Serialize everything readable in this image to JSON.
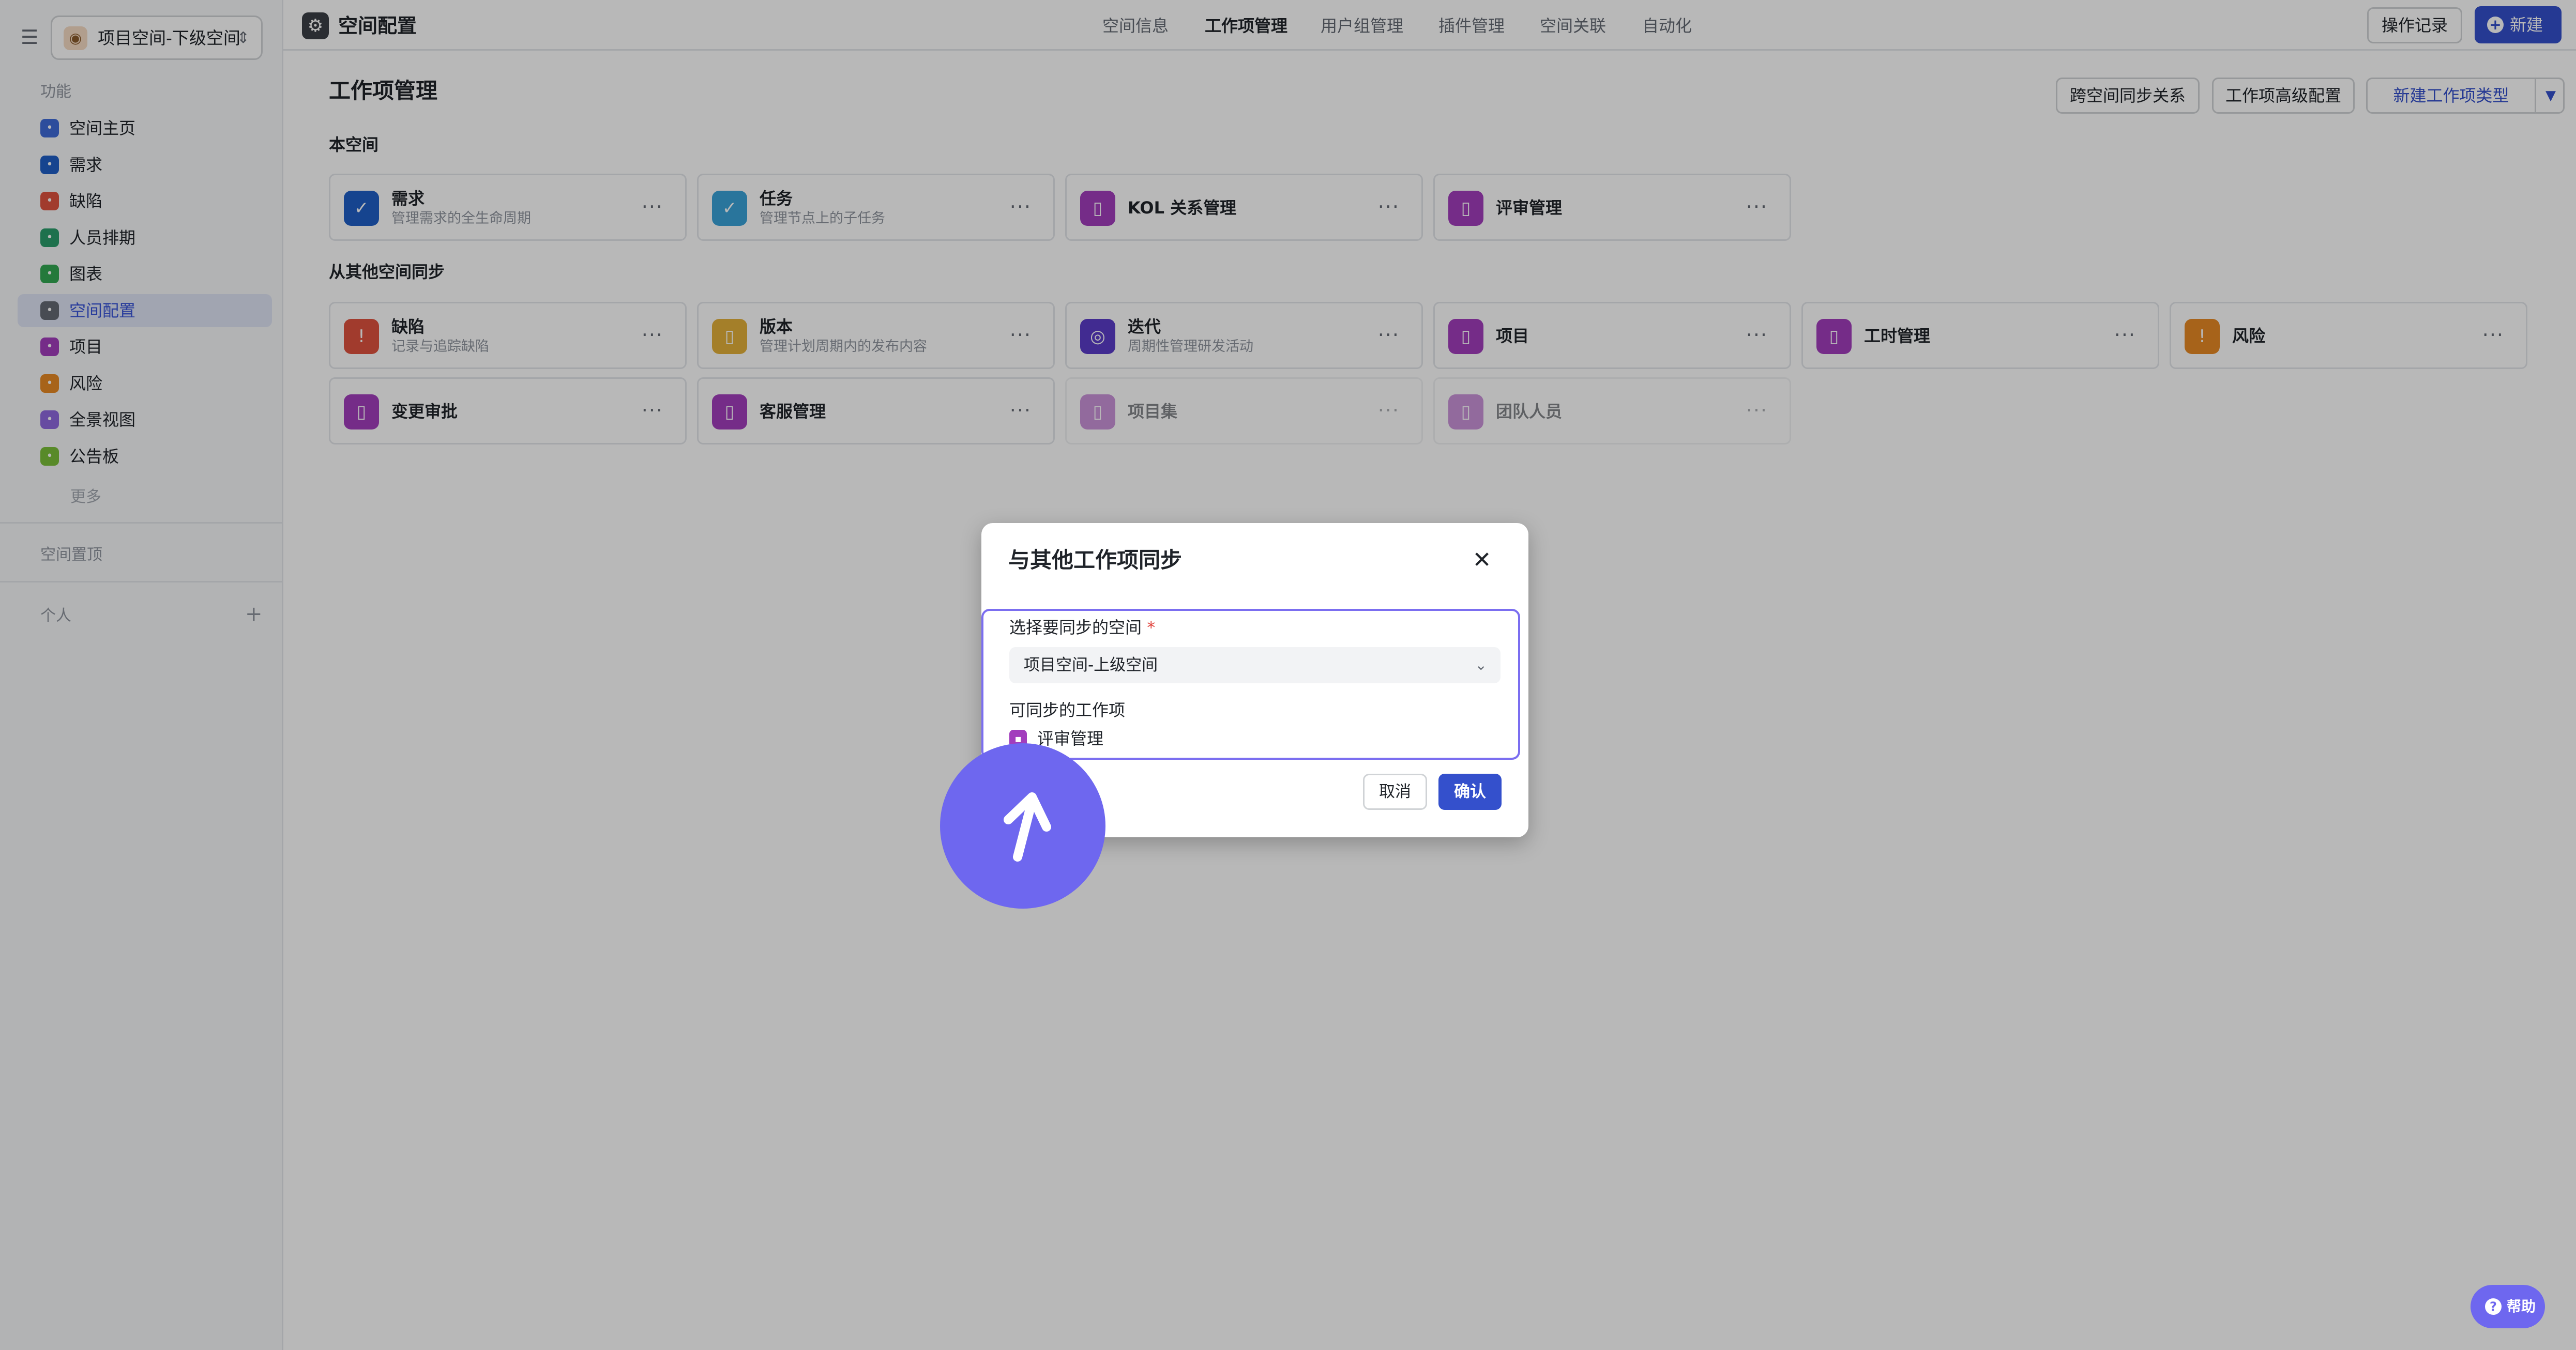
{
  "sidebar": {
    "space_name": "项目空间-下级空间",
    "section_features": "功能",
    "items": [
      {
        "label": "空间主页",
        "icon": "home-icon",
        "color": "#3f6bd8"
      },
      {
        "label": "需求",
        "icon": "requirement-icon",
        "color": "#1f5fc7"
      },
      {
        "label": "缺陷",
        "icon": "bug-icon",
        "color": "#e0523f"
      },
      {
        "label": "人员排期",
        "icon": "schedule-icon",
        "color": "#2a9d6b"
      },
      {
        "label": "图表",
        "icon": "chart-icon",
        "color": "#33a852"
      },
      {
        "label": "空间配置",
        "icon": "gear-icon",
        "color": "#646a73"
      },
      {
        "label": "项目",
        "icon": "project-icon",
        "color": "#a23dbd"
      },
      {
        "label": "风险",
        "icon": "risk-icon",
        "color": "#e88a25"
      },
      {
        "label": "全景视图",
        "icon": "panorama-icon",
        "color": "#8f68e0"
      },
      {
        "label": "公告板",
        "icon": "board-icon",
        "color": "#7bbf3a"
      }
    ],
    "more": "更多",
    "section_pinned": "空间置顶",
    "section_personal": "个人"
  },
  "header": {
    "title": "空间配置",
    "tabs": [
      "空间信息",
      "工作项管理",
      "用户组管理",
      "插件管理",
      "空间关联",
      "自动化"
    ],
    "active_tab": "工作项管理",
    "history_button": "操作记录",
    "new_button": "新建"
  },
  "main": {
    "title": "工作项管理",
    "cross_space_button": "跨空间同步关系",
    "advanced_button": "工作项高级配置",
    "new_type_button": "新建工作项类型",
    "local_group": "本空间",
    "synced_group": "从其他空间同步",
    "local_cards": [
      {
        "name": "需求",
        "desc": "管理需求的全生命周期",
        "icon": "check-circle-icon",
        "color": "#1f5fc7"
      },
      {
        "name": "任务",
        "desc": "管理节点上的子任务",
        "icon": "check-circle-icon",
        "color": "#3aa3d9"
      },
      {
        "name": "KOL 关系管理",
        "desc": "",
        "icon": "bookmark-icon",
        "color": "#a23dbd"
      },
      {
        "name": "评审管理",
        "desc": "",
        "icon": "bookmark-icon",
        "color": "#a23dbd"
      }
    ],
    "synced_cards": [
      {
        "name": "缺陷",
        "desc": "记录与追踪缺陷",
        "icon": "alert-icon",
        "color": "#e0523f"
      },
      {
        "name": "版本",
        "desc": "管理计划周期内的发布内容",
        "icon": "bookmark-icon",
        "color": "#e3b03a"
      },
      {
        "name": "迭代",
        "desc": "周期性管理研发活动",
        "icon": "cycle-icon",
        "color": "#5a3cc9"
      },
      {
        "name": "项目",
        "desc": "",
        "icon": "bookmark-icon",
        "color": "#a23dbd"
      },
      {
        "name": "工时管理",
        "desc": "",
        "icon": "bookmark-icon",
        "color": "#a23dbd"
      },
      {
        "name": "风险",
        "desc": "",
        "icon": "alert-icon",
        "color": "#e88a25"
      },
      {
        "name": "变更审批",
        "desc": "",
        "icon": "bookmark-icon",
        "color": "#a23dbd"
      },
      {
        "name": "客服管理",
        "desc": "",
        "icon": "bookmark-icon",
        "color": "#a23dbd"
      },
      {
        "name": "项目集",
        "desc": "",
        "icon": "bookmark-icon",
        "color": "#a23dbd",
        "dim": true
      },
      {
        "name": "团队人员",
        "desc": "",
        "icon": "bookmark-icon",
        "color": "#a23dbd",
        "dim": true
      }
    ]
  },
  "modal": {
    "title": "与其他工作项同步",
    "space_label": "选择要同步的空间",
    "required_mark": "*",
    "space_value": "项目空间-上级空间",
    "items_label": "可同步的工作项",
    "item": "评审管理",
    "cancel": "取消",
    "confirm": "确认"
  },
  "help": {
    "label": "帮助"
  },
  "colors": {
    "primary": "#3450cc",
    "cursor": "#6e67ef",
    "focus": "#7b6ef0"
  }
}
